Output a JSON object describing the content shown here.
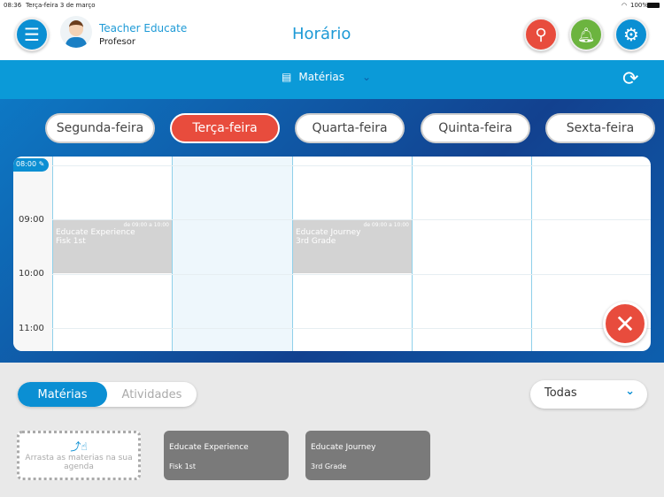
{
  "status": {
    "time": "08:36",
    "date": "Terça-feira 3 de março",
    "battery": "100%"
  },
  "header": {
    "user_name": "Teacher Educate",
    "user_role": "Profesor",
    "title": "Horário"
  },
  "toolbar": {
    "selector": "Matérias"
  },
  "days": [
    "Segunda-feira",
    "Terça-feira",
    "Quarta-feira",
    "Quinta-feira",
    "Sexta-feira"
  ],
  "active_day": 1,
  "calendar": {
    "times": [
      "08:00",
      "09:00",
      "10:00",
      "11:00"
    ],
    "events": [
      {
        "range": "de 09:00 a 10:00",
        "title": "Educate Experience",
        "group": "Fisk 1st"
      },
      {
        "range": "de 09:00 a 10:00",
        "title": "Educate Journey",
        "group": "3rd Grade"
      }
    ]
  },
  "bottom": {
    "tabs": [
      "Matérias",
      "Atividades"
    ],
    "filter": "Todas",
    "drop_hint": "Arrasta as materias na sua agenda",
    "cards": [
      {
        "title": "Educate Experience",
        "group": "Fisk 1st"
      },
      {
        "title": "Educate Journey",
        "group": "3rd Grade"
      }
    ]
  }
}
